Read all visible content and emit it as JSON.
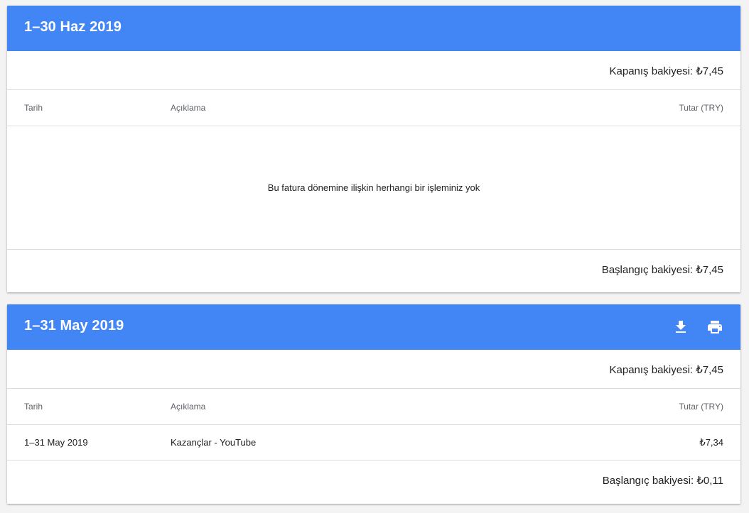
{
  "colors": {
    "header_bg": "#4285f4",
    "header_text": "#ffffff",
    "divider": "#dadce0",
    "muted_text": "#5f6368"
  },
  "statements": [
    {
      "title": "1–30 Haz 2019",
      "closing_balance": "Kapanış bakiyesi: ₺7,45",
      "columns": {
        "date": "Tarih",
        "description": "Açıklama",
        "amount": "Tutar (TRY)"
      },
      "empty_message": "Bu fatura dönemine ilişkin herhangi bir işleminiz yok",
      "opening_balance": "Başlangıç bakiyesi: ₺7,45"
    },
    {
      "title": "1–31 May 2019",
      "actions": [
        {
          "icon": "download-icon"
        },
        {
          "icon": "print-icon"
        }
      ],
      "closing_balance": "Kapanış bakiyesi: ₺7,45",
      "columns": {
        "date": "Tarih",
        "description": "Açıklama",
        "amount": "Tutar (TRY)"
      },
      "rows": [
        {
          "date": "1–31 May 2019",
          "description": "Kazançlar - YouTube",
          "amount": "₺7,34"
        }
      ],
      "opening_balance": "Başlangıç bakiyesi: ₺0,11"
    }
  ]
}
